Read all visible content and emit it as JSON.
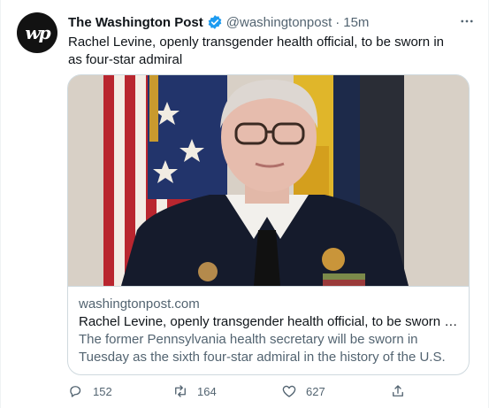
{
  "tweet": {
    "author_name": "The Washington Post",
    "handle": "@washingtonpost",
    "separator": "·",
    "time": "15m",
    "avatar_text": "wp",
    "text": "Rachel Levine, openly transgender health official, to be sworn in as four-star admiral"
  },
  "card": {
    "domain": "washingtonpost.com",
    "title": "Rachel Levine, openly transgender health official, to be sworn in as fo...",
    "description": "The former Pennsylvania health secretary will be sworn in Tuesday as the sixth four-star admiral in the history of the U.S. Public Health ..."
  },
  "actions": {
    "replies": "152",
    "retweets": "164",
    "likes": "627"
  },
  "icons": [
    "verified-icon",
    "more-icon",
    "reply-icon",
    "retweet-icon",
    "like-icon",
    "share-icon"
  ],
  "colors": {
    "verified": "#1d9bf0",
    "text_secondary": "#536471",
    "border": "#cfd9de"
  }
}
